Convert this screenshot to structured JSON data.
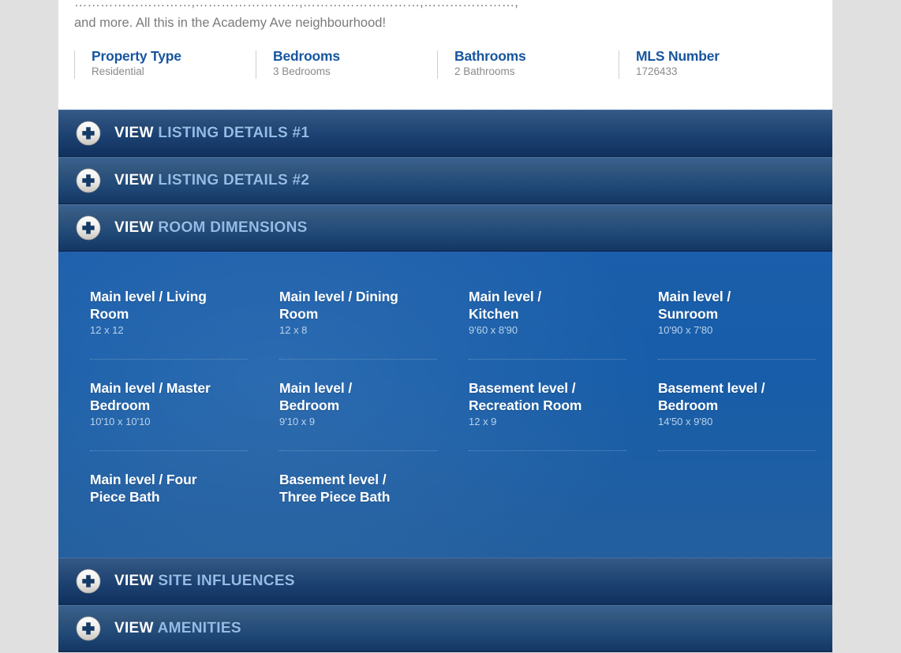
{
  "listing": {
    "description_line_top": "………………………,……………………,………………………,…………………,",
    "description": "and more. All this in the Academy Ave neighbourhood!",
    "facts": [
      {
        "title": "Property Type",
        "value": "Residential"
      },
      {
        "title": "Bedrooms",
        "value": "3 Bedrooms"
      },
      {
        "title": "Bathrooms",
        "value": "2 Bathrooms"
      },
      {
        "title": "MLS Number",
        "value": "1726433"
      }
    ]
  },
  "accordions": {
    "view_word": "VIEW",
    "items": [
      {
        "name": "LISTING DETAILS #1",
        "expanded": false
      },
      {
        "name": "LISTING DETAILS #2",
        "expanded": false
      },
      {
        "name": "ROOM DIMENSIONS",
        "expanded": true
      },
      {
        "name": "SITE INFLUENCES",
        "expanded": false
      },
      {
        "name": "AMENITIES",
        "expanded": false
      }
    ]
  },
  "room_dimensions": {
    "rows": [
      [
        {
          "name": "Main level / Living Room",
          "dimensions": "12 x 12"
        },
        {
          "name": "Main level / Dining Room",
          "dimensions": "12 x 8"
        },
        {
          "name": "Main level / Kitchen",
          "dimensions": "9'60 x 8'90"
        },
        {
          "name": "Main level / Sunroom",
          "dimensions": "10'90 x 7'80"
        }
      ],
      [
        {
          "name": "Main level / Master Bedroom",
          "dimensions": "10'10 x 10'10"
        },
        {
          "name": "Main level / Bedroom",
          "dimensions": "9'10 x 9"
        },
        {
          "name": "Basement level / Recreation Room",
          "dimensions": "12 x 9"
        },
        {
          "name": "Basement level / Bedroom",
          "dimensions": "14'50 x 9'80"
        }
      ],
      [
        {
          "name": "Main level / Four Piece Bath",
          "dimensions": ""
        },
        {
          "name": "Basement level / Three Piece Bath",
          "dimensions": ""
        }
      ]
    ]
  },
  "colors": {
    "page_background": "#e0e0e0",
    "card_background": "#ffffff",
    "fact_title": "#17569e",
    "fact_value": "#8a8a8a",
    "accordion_top": "#335a88",
    "accordion_bottom": "#11305d",
    "accordion_view_text": "#ffffff",
    "accordion_name_text": "#94bce8",
    "panel_blue": "#175da9",
    "room_name_text": "#ffffff",
    "room_dim_text": "#b9d2ea",
    "dotted_rule": "#6e9ccb"
  }
}
